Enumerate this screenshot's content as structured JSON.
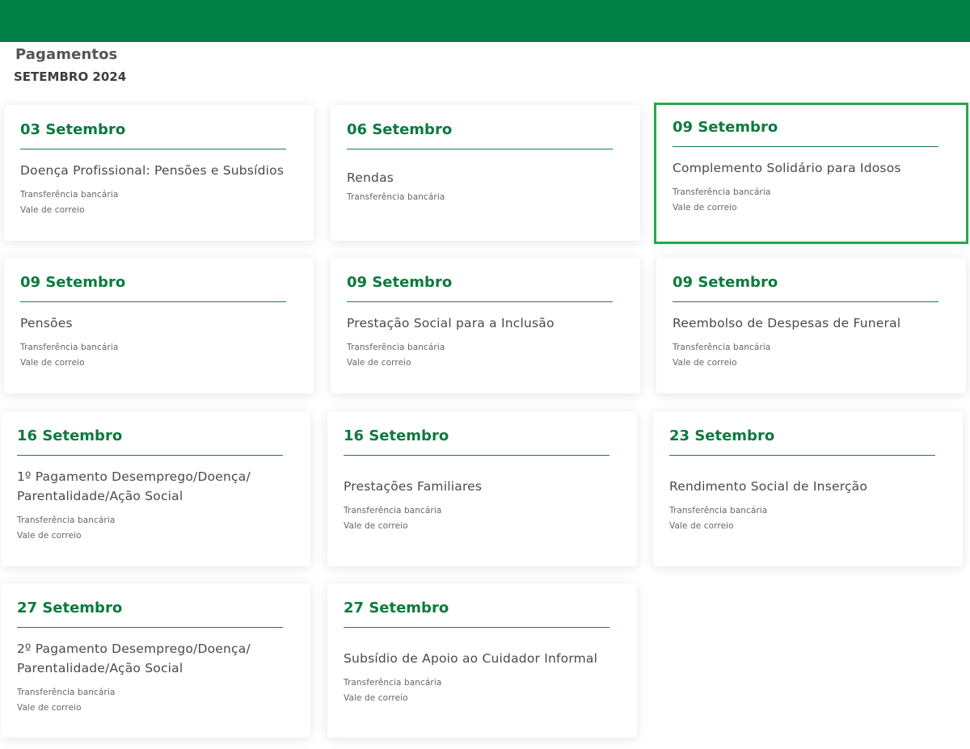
{
  "page": {
    "title": "Pagamentos",
    "subtitle": "SETEMBRO 2024"
  },
  "colors": {
    "header": "#007f46",
    "date": "#0d7a3e",
    "selected_border": "#29a74a"
  },
  "cards": [
    {
      "date": "03 Setembro",
      "title": "Doença Profissional: Pensões e Subsídios",
      "methods": [
        "Transferência bancária",
        "Vale de correio"
      ]
    },
    {
      "date": "06 Setembro",
      "title": "Rendas",
      "methods": [
        "Transferência bancária"
      ]
    },
    {
      "date": "09 Setembro",
      "title": "Complemento Solidário para Idosos",
      "methods": [
        "Transferência bancária",
        "Vale de correio"
      ]
    },
    {
      "date": "09 Setembro",
      "title": "Pensões",
      "methods": [
        "Transferência bancária",
        "Vale de correio"
      ]
    },
    {
      "date": "09 Setembro",
      "title": "Prestação Social para a Inclusão",
      "methods": [
        "Transferência bancária",
        "Vale de correio"
      ]
    },
    {
      "date": "09 Setembro",
      "title": "Reembolso de Despesas de Funeral",
      "methods": [
        "Transferência bancária",
        "Vale de correio"
      ]
    },
    {
      "date": "16 Setembro",
      "title": "1º Pagamento Desemprego/Doença/ Parentalidade/Ação Social",
      "methods": [
        "Transferência bancária",
        "Vale de correio"
      ]
    },
    {
      "date": "16 Setembro",
      "title": "Prestações Familiares",
      "methods": [
        "Transferência bancária",
        "Vale de correio"
      ]
    },
    {
      "date": "23 Setembro",
      "title": "Rendimento Social de Inserção",
      "methods": [
        "Transferência bancária",
        "Vale de correio"
      ]
    },
    {
      "date": "27 Setembro",
      "title": "2º Pagamento Desemprego/Doença/ Parentalidade/Ação Social",
      "methods": [
        "Transferência bancária",
        "Vale de correio"
      ]
    },
    {
      "date": "27 Setembro",
      "title": "Subsídio de Apoio ao Cuidador Informal",
      "methods": [
        "Transferência bancária",
        "Vale de correio"
      ]
    }
  ]
}
